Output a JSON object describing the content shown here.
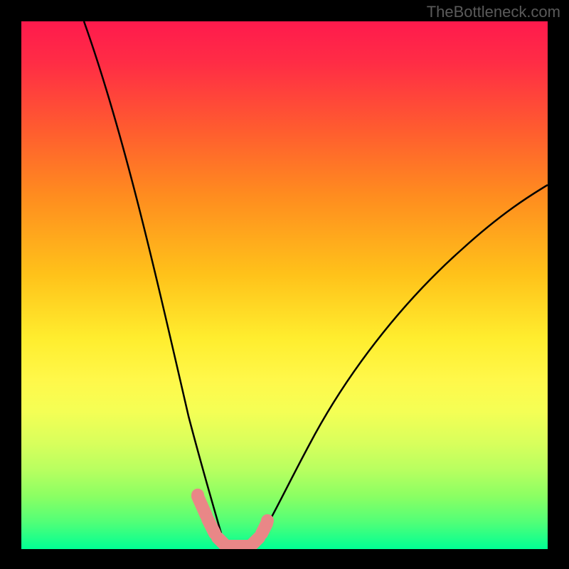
{
  "watermark": "TheBottleneck.com",
  "chart_data": {
    "type": "line",
    "title": "",
    "xlabel": "",
    "ylabel": "",
    "xlim": [
      0,
      100
    ],
    "ylim": [
      0,
      100
    ],
    "series": [
      {
        "name": "left-curve",
        "x": [
          12,
          14,
          17,
          20,
          23,
          26,
          28,
          30,
          32,
          33.5,
          35,
          36.5,
          38
        ],
        "values": [
          100,
          88,
          73,
          60,
          48,
          37,
          29,
          22,
          15,
          10,
          6,
          3,
          0.5
        ]
      },
      {
        "name": "right-curve",
        "x": [
          44.5,
          46,
          48,
          51,
          55,
          60,
          66,
          73,
          81,
          90,
          100
        ],
        "values": [
          0.5,
          3,
          7,
          13,
          20,
          28,
          36,
          44,
          52,
          59,
          66
        ]
      },
      {
        "name": "valley-floor",
        "x": [
          38,
          40,
          42,
          44.5
        ],
        "values": [
          0.5,
          0,
          0,
          0.5
        ]
      }
    ],
    "markers": {
      "name": "highlighted-points",
      "color": "#e98787",
      "points_xy": [
        [
          33.5,
          10
        ],
        [
          34.5,
          7
        ],
        [
          35.5,
          4.5
        ],
        [
          37,
          2
        ],
        [
          38.5,
          0.8
        ],
        [
          40,
          0.2
        ],
        [
          41.5,
          0.2
        ],
        [
          43,
          0.6
        ],
        [
          44.5,
          1.6
        ],
        [
          45.5,
          3.2
        ],
        [
          46.5,
          5.2
        ]
      ]
    },
    "background_gradient": {
      "top_color": "#ff1a4d",
      "bottom_color": "#00ff94"
    }
  }
}
